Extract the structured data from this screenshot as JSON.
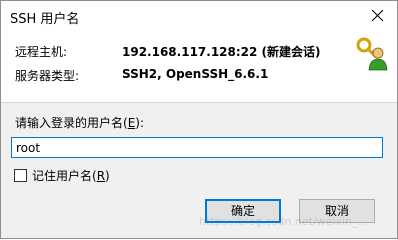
{
  "window": {
    "title": "SSH 用户名"
  },
  "info": {
    "remote_host_label": "远程主机:",
    "remote_host_value": "192.168.117.128:22 (新建会话)",
    "server_type_label": "服务器类型:",
    "server_type_value": "SSH2, OpenSSH_6.6.1",
    "icon": "keys-user-icon"
  },
  "prompt": {
    "label_text": "请输入登录的用户名(",
    "hotkey": "E",
    "label_suffix": "):"
  },
  "username_input": {
    "value": "root"
  },
  "remember": {
    "label_text": "记住用户名(",
    "hotkey": "R",
    "label_suffix": ")",
    "checked": false
  },
  "buttons": {
    "ok": "确定",
    "cancel": "取消"
  },
  "watermark": "https://blog.csdn.net/weixin_..."
}
